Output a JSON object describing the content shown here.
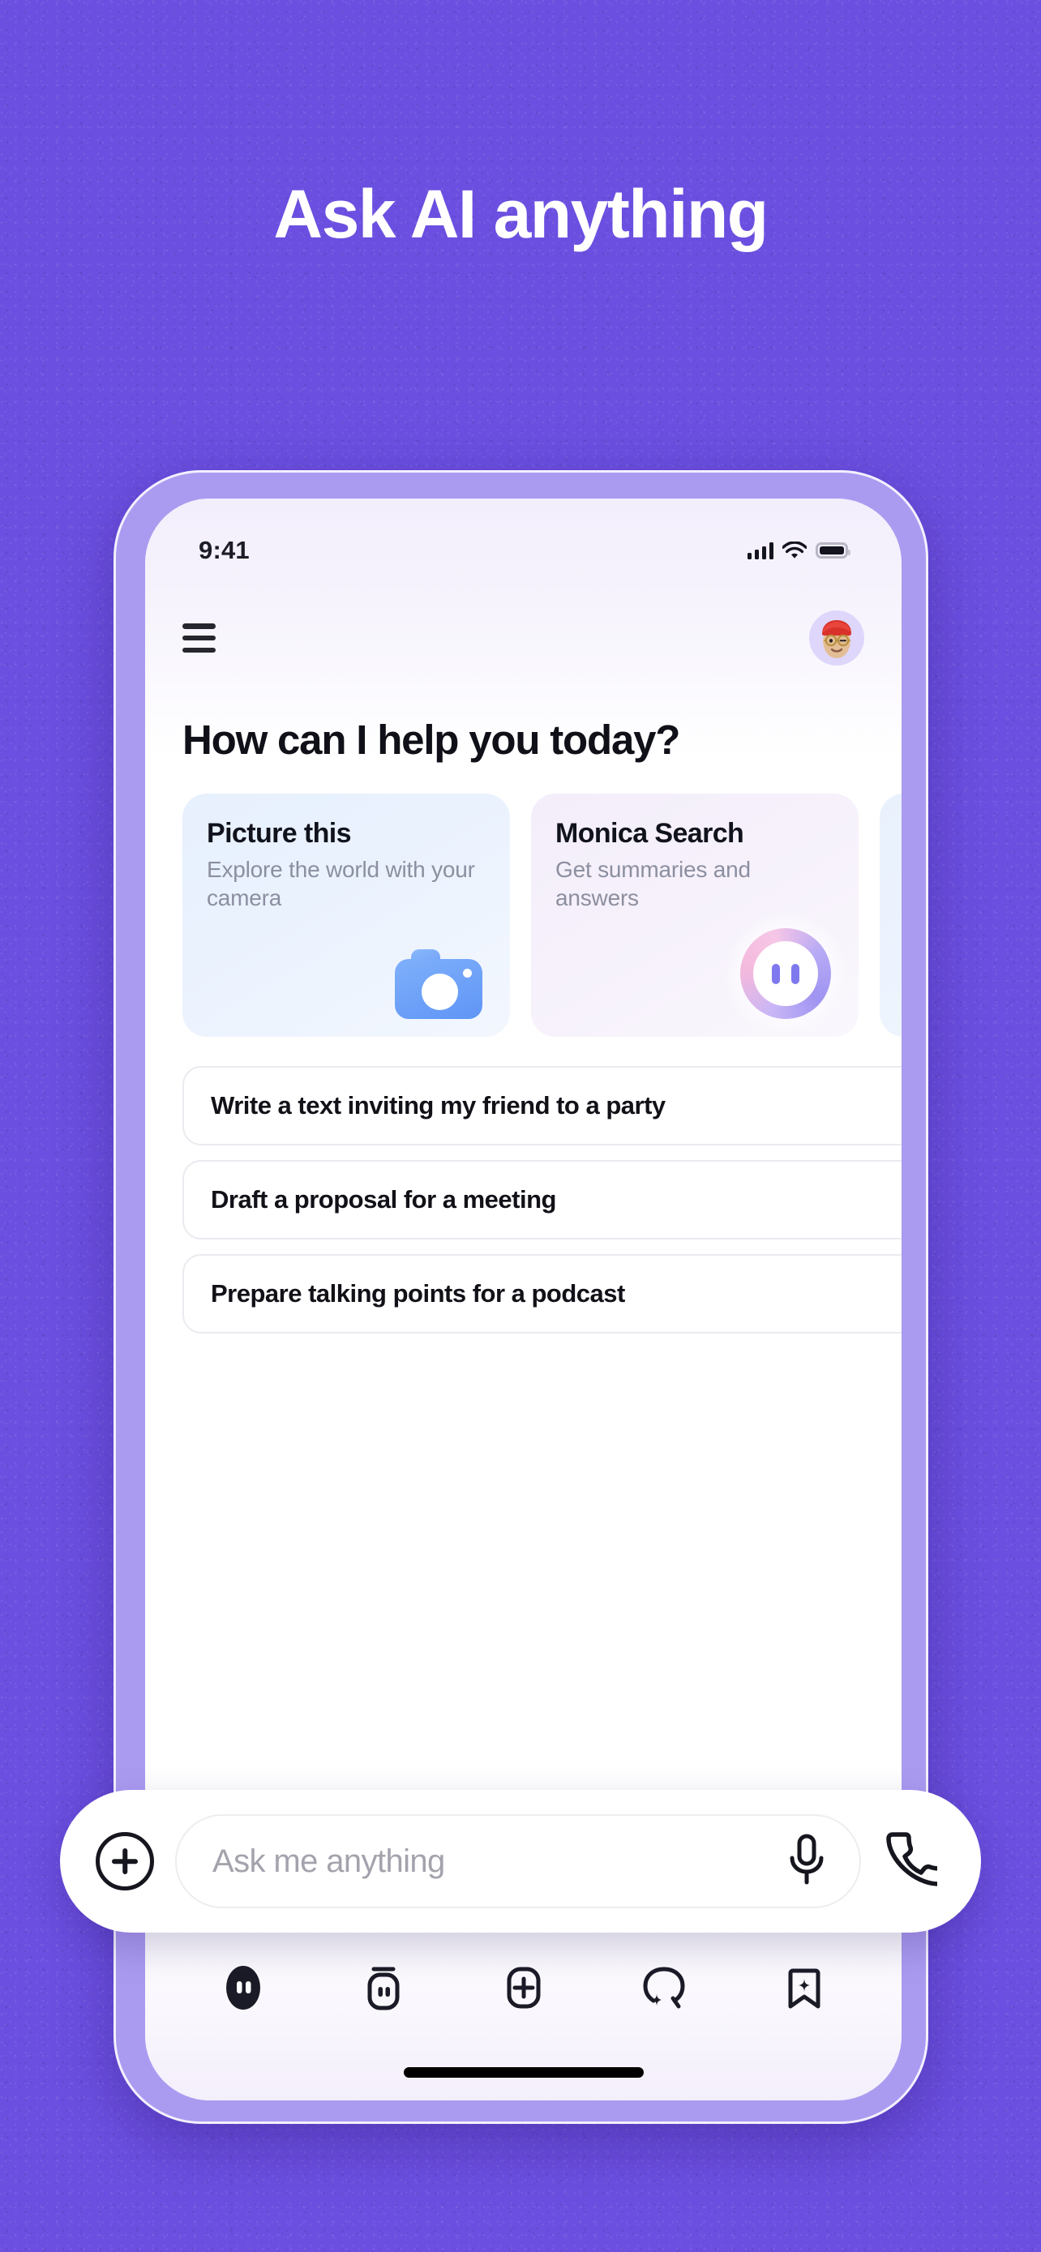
{
  "poster": {
    "headline": "Ask AI anything",
    "background_color": "#6b4fe0",
    "headline_color": "#ffffff"
  },
  "phone": {
    "bezel_color": "#ab9bf0",
    "screen_color": "#ffffff"
  },
  "status_bar": {
    "time": "9:41",
    "signal_icon": "cellular-signal-icon",
    "wifi_icon": "wifi-icon",
    "battery_icon": "battery-full-icon"
  },
  "app_header": {
    "menu_icon": "hamburger-menu-icon",
    "avatar_icon": "user-avatar-memoji"
  },
  "main": {
    "greeting": "How can I help you today?",
    "cards": [
      {
        "title": "Picture this",
        "subtitle": "Explore the world with your camera",
        "icon": "camera-icon",
        "accent": "#6f9ff7"
      },
      {
        "title": "Monica Search",
        "subtitle": "Get summaries and answers",
        "icon": "monica-face-icon",
        "accent": "#b7aaf5"
      },
      {
        "title": "",
        "subtitle": "",
        "icon": "",
        "accent": "#e9f1fd"
      }
    ],
    "suggestions": [
      {
        "label": "Write a text inviting my friend to a party",
        "chevron": "chevron-right-icon"
      },
      {
        "label": "Draft a proposal for a meeting",
        "chevron": "chevron-right-icon"
      },
      {
        "label": "Prepare talking points for a podcast",
        "chevron": "chevron-right-icon"
      }
    ]
  },
  "composer": {
    "add_icon": "plus-circle-icon",
    "placeholder": "Ask me anything",
    "value": "",
    "mic_icon": "microphone-icon",
    "call_icon": "phone-call-icon"
  },
  "tab_bar": {
    "items": [
      {
        "icon": "monica-face-filled-icon",
        "active": true
      },
      {
        "icon": "bot-outline-icon",
        "active": false
      },
      {
        "icon": "plus-square-icon",
        "active": false
      },
      {
        "icon": "sparkle-chat-icon",
        "active": false
      },
      {
        "icon": "bookmark-sparkle-icon",
        "active": false
      }
    ]
  },
  "home_indicator": "home-indicator-bar"
}
